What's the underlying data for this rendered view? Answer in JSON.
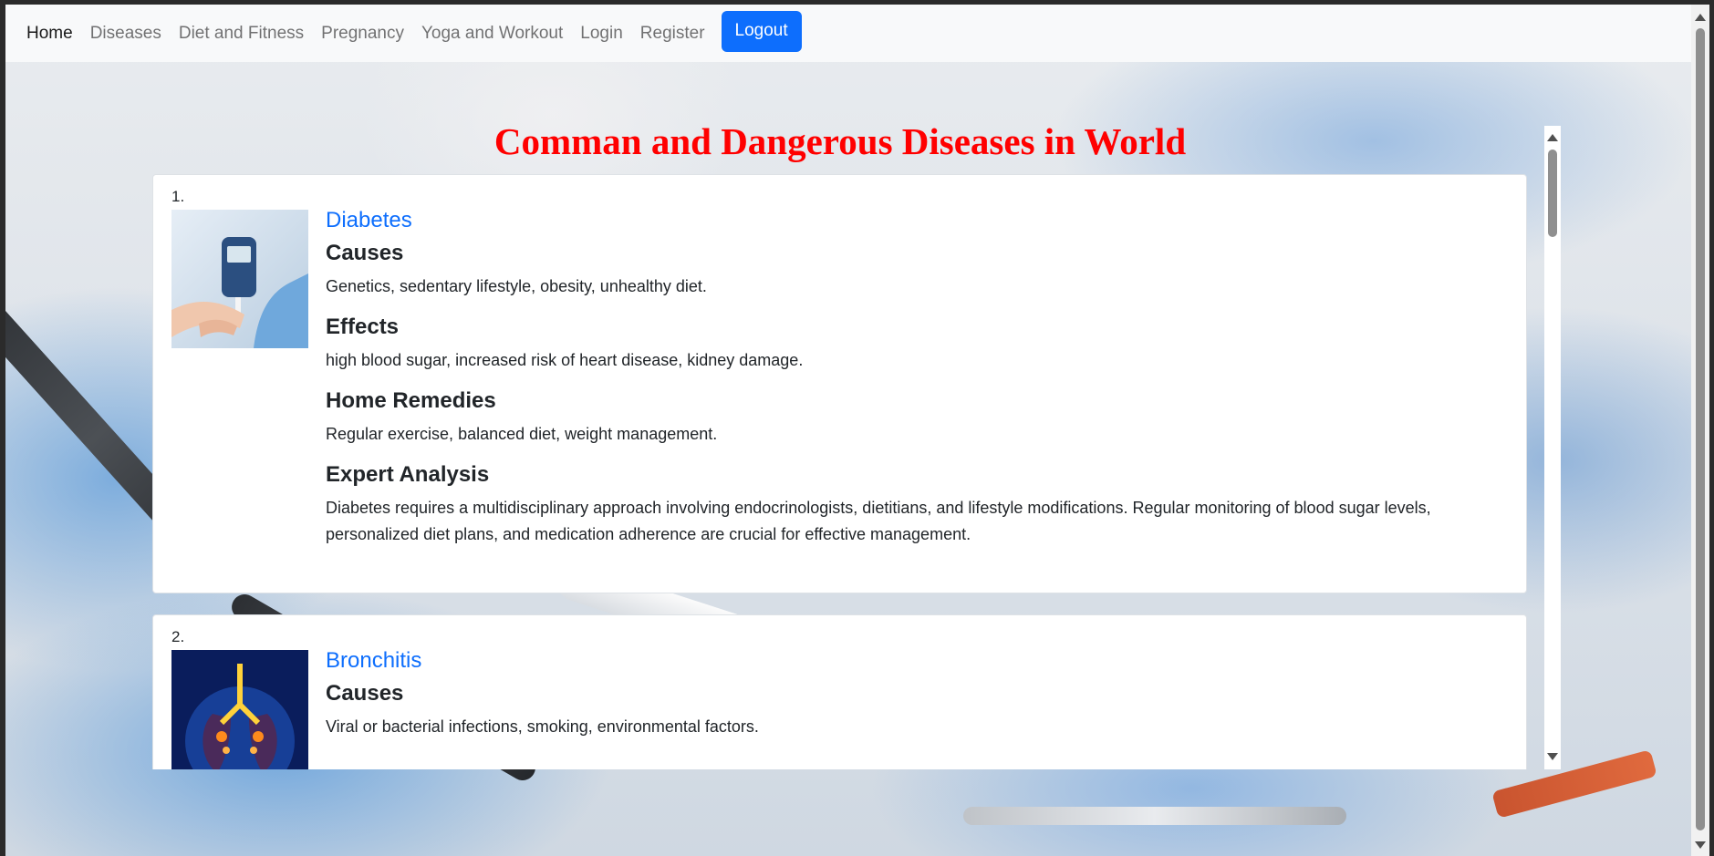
{
  "nav": {
    "home": "Home",
    "diseases": "Diseases",
    "diet_fitness": "Diet and Fitness",
    "pregnancy": "Pregnancy",
    "yoga_workout": "Yoga and Workout",
    "login": "Login",
    "register": "Register",
    "logout": "Logout"
  },
  "page_title": "Comman and Dangerous Diseases in World",
  "diseases": [
    {
      "number": "1.",
      "name": "Diabetes",
      "causes_heading": "Causes",
      "causes": "Genetics, sedentary lifestyle, obesity, unhealthy diet.",
      "effects_heading": "Effects",
      "effects": "high blood sugar, increased risk of heart disease, kidney damage.",
      "remedies_heading": "Home Remedies",
      "remedies": "Regular exercise, balanced diet, weight management.",
      "analysis_heading": "Expert Analysis",
      "analysis": "Diabetes requires a multidisciplinary approach involving endocrinologists, dietitians, and lifestyle modifications. Regular monitoring of blood sugar levels, personalized diet plans, and medication adherence are crucial for effective management."
    },
    {
      "number": "2.",
      "name": "Bronchitis",
      "causes_heading": "Causes",
      "causes": "Viral or bacterial infections, smoking, environmental factors."
    }
  ],
  "colors": {
    "title_red": "#ff0000",
    "link_blue": "#0d6efd",
    "navbar_bg": "#f8f9fa"
  }
}
